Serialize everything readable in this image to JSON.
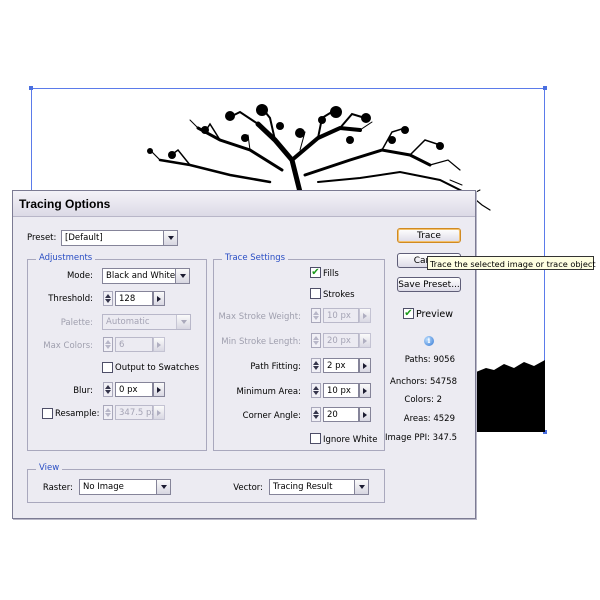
{
  "dialog": {
    "title": "Tracing Options",
    "preset": {
      "label": "Preset:",
      "value": "[Default]"
    },
    "adjustments": {
      "title": "Adjustments",
      "mode": {
        "label": "Mode:",
        "value": "Black and White"
      },
      "threshold": {
        "label": "Threshold:",
        "value": "128"
      },
      "palette": {
        "label": "Palette:",
        "value": "Automatic"
      },
      "max_colors": {
        "label": "Max Colors:",
        "value": "6"
      },
      "output_to_swatches": {
        "label": "Output to Swatches",
        "checked": false
      },
      "blur": {
        "label": "Blur:",
        "value": "0 px"
      },
      "resample": {
        "label": "Resample:",
        "value": "347.5 px",
        "checked": false
      }
    },
    "trace_settings": {
      "title": "Trace Settings",
      "fills": {
        "label": "Fills",
        "checked": true
      },
      "strokes": {
        "label": "Strokes",
        "checked": false
      },
      "max_stroke_weight": {
        "label": "Max Stroke Weight:",
        "value": "10 px"
      },
      "min_stroke_length": {
        "label": "Min Stroke Length:",
        "value": "20 px"
      },
      "path_fitting": {
        "label": "Path Fitting:",
        "value": "2 px"
      },
      "minimum_area": {
        "label": "Minimum Area:",
        "value": "10 px"
      },
      "corner_angle": {
        "label": "Corner Angle:",
        "value": "20"
      },
      "ignore_white": {
        "label": "Ignore White",
        "checked": false
      }
    },
    "view": {
      "title": "View",
      "raster": {
        "label": "Raster:",
        "value": "No Image"
      },
      "vector": {
        "label": "Vector:",
        "value": "Tracing Result"
      }
    },
    "buttons": {
      "trace": "Trace",
      "cancel": "Cancel",
      "save_preset": "Save Preset..."
    },
    "preview": {
      "label": "Preview",
      "checked": true
    },
    "stats": {
      "paths": {
        "label": "Paths:",
        "value": "9056"
      },
      "anchors": {
        "label": "Anchors:",
        "value": "54758"
      },
      "colors": {
        "label": "Colors:",
        "value": "2"
      },
      "areas": {
        "label": "Areas:",
        "value": "4529"
      },
      "image_ppi": {
        "label": "Image PPI:",
        "value": "347.5"
      }
    }
  },
  "tooltip": "Trace the selected image or trace object",
  "icons": {
    "check": "checkmark-icon",
    "info": "info-icon",
    "dropdown": "chevron-down-icon",
    "spinner": "spinner-arrows-icon",
    "step": "triangle-right-icon"
  },
  "colors": {
    "selection": "#5b7bea",
    "group_title": "#2a4ec4",
    "default_button_border": "#d08a22",
    "checkmark": "#1a9a1a",
    "tooltip_bg": "#ffffe1"
  }
}
